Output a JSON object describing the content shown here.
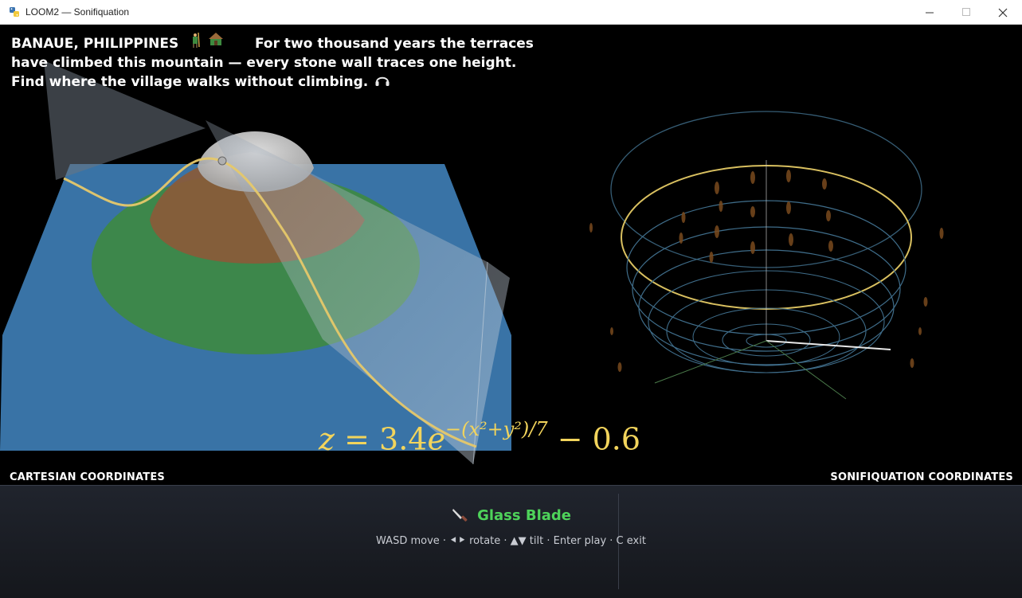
{
  "window": {
    "title": "LOOM2 — Sonifiquation",
    "controls": [
      "minimize",
      "maximize",
      "close"
    ]
  },
  "intro": {
    "place": "BANAUE, PHILIPPINES",
    "line1": "For two thousand years the terraces",
    "line2": "have climbed this mountain — every stone wall traces one height.",
    "line3": "Find where the village walks without climbing."
  },
  "formula": {
    "lhs": "z",
    "coef": "3.4",
    "exponent_text": "−(x²+y²)/7",
    "offset": "− 0.6"
  },
  "labels": {
    "cartesian": "CARTESIAN COORDINATES",
    "sonification": "SONIFIQUATION COORDINATES"
  },
  "tool": {
    "name": "Glass Blade",
    "hint": "WASD move · ⯇⯈ rotate · ▲▼ tilt · Enter play · C exit"
  },
  "icons": {
    "app": "python-app-icon",
    "farmer": "farmer-icon",
    "hut": "hut-icon",
    "headphones": "headphones-icon",
    "knife": "knife-icon"
  },
  "colors": {
    "intro_text": "#ffffff",
    "formula": "#f2d45c",
    "tool_name": "#4ed35a",
    "water_plane": "#3f7fb8",
    "terrace_green": "#3d8a3f",
    "terrace_brown": "#8a5a38",
    "peak_cap": "#cfcfcf",
    "contour_curve": "#e6c86a",
    "ring_blue": "#3f6d8a",
    "highlight_ring": "#d9c060"
  }
}
